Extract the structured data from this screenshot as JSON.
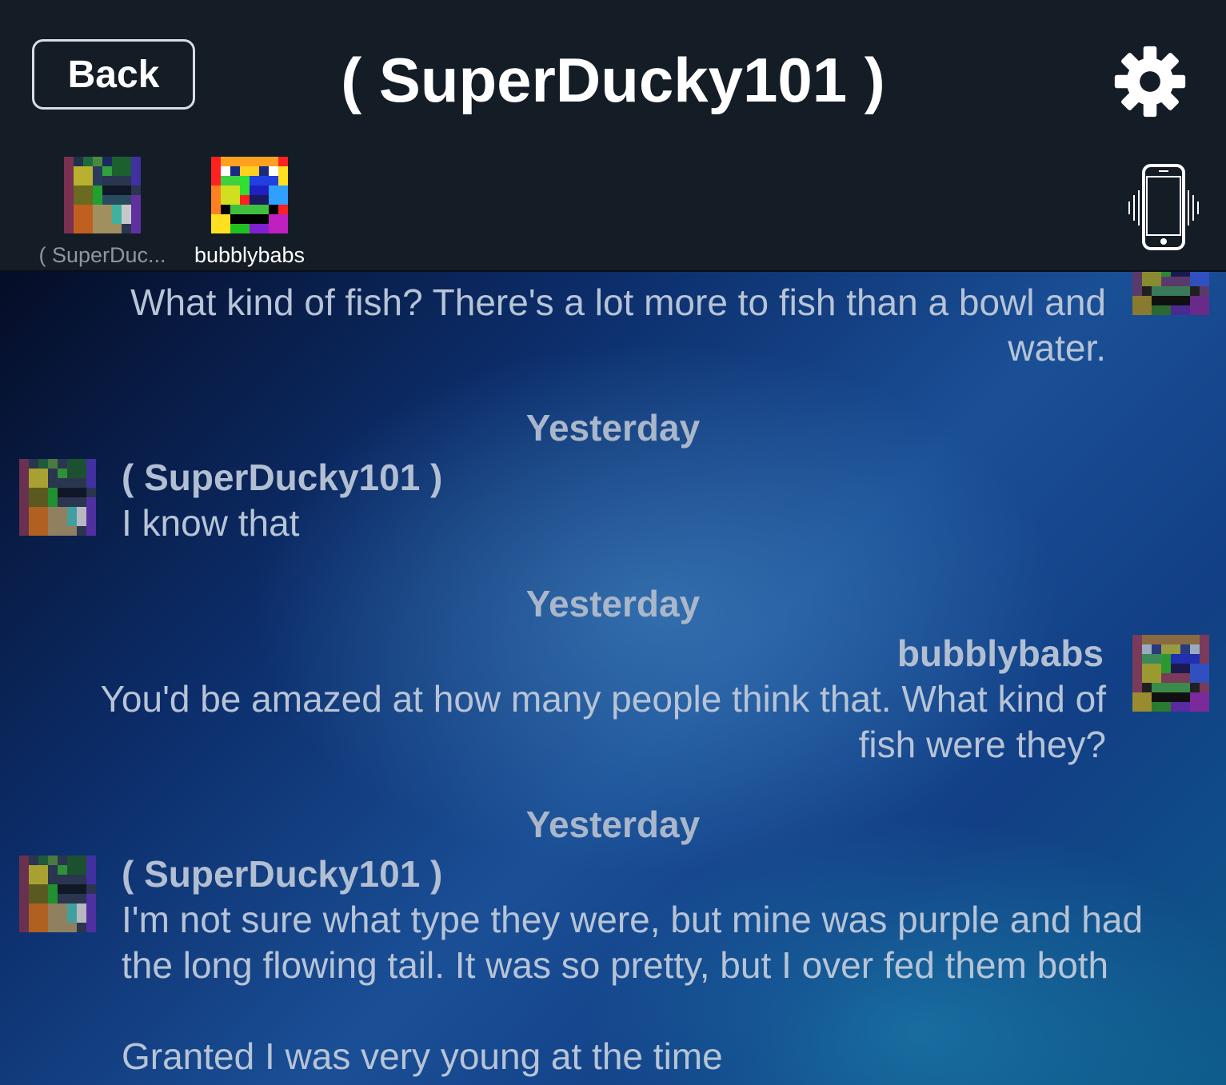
{
  "header": {
    "back_label": "Back",
    "title": "( SuperDucky101 )",
    "settings_icon": "gear-icon",
    "vibrate_icon": "phone-vibrate-icon"
  },
  "participants": [
    {
      "name": "( SuperDuc...",
      "color": "#8f96a0"
    },
    {
      "name": "bubblybabs",
      "color": "#ffffff"
    }
  ],
  "messages": {
    "m0": {
      "text_line1": "What kind of fish?  There's a lot more to fish than a bowl and",
      "text_line2": "water."
    },
    "t1": "Yesterday",
    "m1": {
      "sender": "( SuperDucky101 )",
      "text": "I know that"
    },
    "t2": "Yesterday",
    "m2": {
      "sender": "bubblybabs",
      "text_line1": "You'd be amazed at how many people think that.  What kind of",
      "text_line2": "fish were they?"
    },
    "t3": "Yesterday",
    "m3": {
      "sender": "( SuperDucky101 )",
      "text_line1": "I'm not sure what type they were, but mine was purple and had",
      "text_line2": "the long flowing tail. It was so pretty, but I over fed them both",
      "text_line3": "Granted I was very young at the time"
    }
  }
}
